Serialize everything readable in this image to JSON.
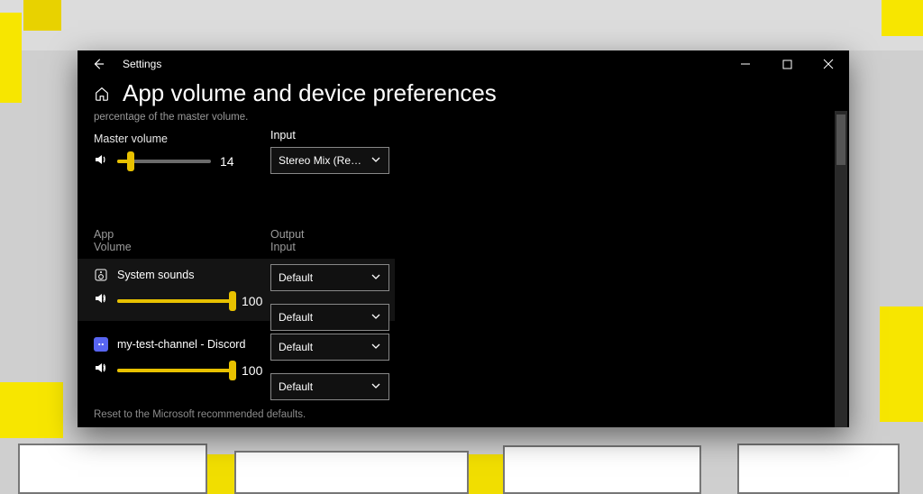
{
  "window": {
    "app_title": "Settings",
    "page_title": "App volume and device preferences"
  },
  "master": {
    "description_line2": "percentage of the master volume.",
    "label": "Master volume",
    "value": "14",
    "fill_pct": "14%"
  },
  "input_section": {
    "label": "Input",
    "selected": "Stereo Mix (Realtek..."
  },
  "column_headers": {
    "app": "App",
    "volume": "Volume",
    "output": "Output",
    "input": "Input"
  },
  "apps": {
    "system_sounds": {
      "name": "System sounds",
      "value": "100",
      "fill_pct": "100%",
      "output": "Default",
      "input": "Default"
    },
    "discord": {
      "name": "my-test-channel - Discord",
      "value": "100",
      "fill_pct": "100%",
      "output": "Default",
      "input": "Default"
    }
  },
  "footer": "Reset to the Microsoft recommended defaults."
}
